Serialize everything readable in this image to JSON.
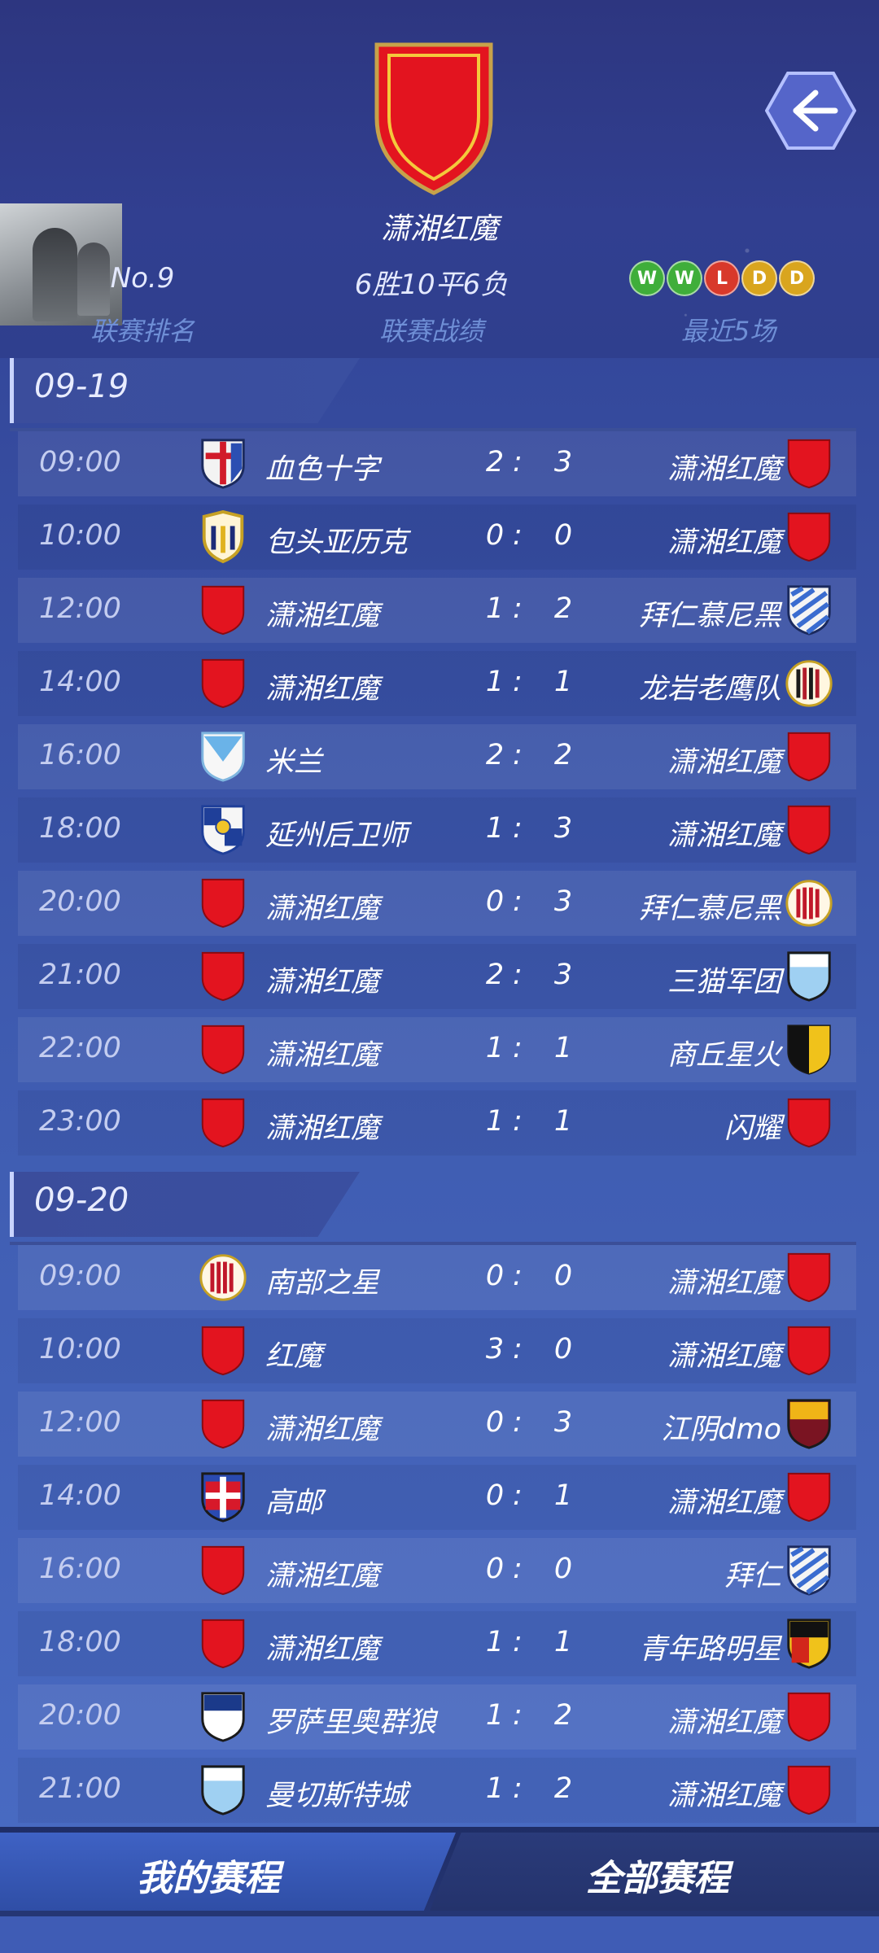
{
  "header": {
    "team_name": "潇湘红魔",
    "rank_value": "No.9",
    "rank_label": "联赛排名",
    "record_value": "6胜10平6负",
    "record_label": "联赛战绩",
    "recent_label": "最近5场",
    "recent_form": [
      {
        "r": "W",
        "color": "#3fae3a"
      },
      {
        "r": "W",
        "color": "#3fae3a"
      },
      {
        "r": "L",
        "color": "#d8392b"
      },
      {
        "r": "D",
        "color": "#d9a51e"
      },
      {
        "r": "D",
        "color": "#d9a51e"
      }
    ]
  },
  "dates": [
    {
      "date": "09-19",
      "matches": [
        {
          "time": "09:00",
          "home": "血色十字",
          "home_crest": "cross-shield",
          "hs": "2",
          "as": "3",
          "away": "潇湘红魔",
          "away_crest": "red-shield"
        },
        {
          "time": "10:00",
          "home": "包头亚历克",
          "home_crest": "gold-stripe-shield",
          "hs": "0",
          "as": "0",
          "away": "潇湘红魔",
          "away_crest": "red-shield"
        },
        {
          "time": "12:00",
          "home": "潇湘红魔",
          "home_crest": "red-shield",
          "hs": "1",
          "as": "2",
          "away": "拜仁慕尼黑",
          "away_crest": "blue-diagonal-shield"
        },
        {
          "time": "14:00",
          "home": "潇湘红魔",
          "home_crest": "red-shield",
          "hs": "1",
          "as": "1",
          "away": "龙岩老鹰队",
          "away_crest": "striped-round-badge"
        },
        {
          "time": "16:00",
          "home": "米兰",
          "home_crest": "light-blue-shield",
          "hs": "2",
          "as": "2",
          "away": "潇湘红魔",
          "away_crest": "red-shield"
        },
        {
          "time": "18:00",
          "home": "延州后卫师",
          "home_crest": "blue-cross-shield",
          "hs": "1",
          "as": "3",
          "away": "潇湘红魔",
          "away_crest": "red-shield"
        },
        {
          "time": "20:00",
          "home": "潇湘红魔",
          "home_crest": "red-shield",
          "hs": "0",
          "as": "3",
          "away": "拜仁慕尼黑",
          "away_crest": "red-stripe-round"
        },
        {
          "time": "21:00",
          "home": "潇湘红魔",
          "home_crest": "red-shield",
          "hs": "2",
          "as": "3",
          "away": "三猫军团",
          "away_crest": "sky-half-shield"
        },
        {
          "time": "22:00",
          "home": "潇湘红魔",
          "home_crest": "red-shield",
          "hs": "1",
          "as": "1",
          "away": "商丘星火",
          "away_crest": "black-yellow-shield"
        },
        {
          "time": "23:00",
          "home": "潇湘红魔",
          "home_crest": "red-shield",
          "hs": "1",
          "as": "1",
          "away": "闪耀",
          "away_crest": "red-shield"
        }
      ]
    },
    {
      "date": "09-20",
      "matches": [
        {
          "time": "09:00",
          "home": "南部之星",
          "home_crest": "red-stripe-round",
          "hs": "0",
          "as": "0",
          "away": "潇湘红魔",
          "away_crest": "red-shield"
        },
        {
          "time": "10:00",
          "home": "红魔",
          "home_crest": "red-shield",
          "hs": "3",
          "as": "0",
          "away": "潇湘红魔",
          "away_crest": "red-shield"
        },
        {
          "time": "12:00",
          "home": "潇湘红魔",
          "home_crest": "red-shield",
          "hs": "0",
          "as": "3",
          "away": "江阴dmo",
          "away_crest": "gold-maroon-shield"
        },
        {
          "time": "14:00",
          "home": "高邮",
          "home_crest": "red-blue-cross-shield",
          "hs": "0",
          "as": "1",
          "away": "潇湘红魔",
          "away_crest": "red-shield"
        },
        {
          "time": "16:00",
          "home": "潇湘红魔",
          "home_crest": "red-shield",
          "hs": "0",
          "as": "0",
          "away": "拜仁",
          "away_crest": "blue-diagonal-shield"
        },
        {
          "time": "18:00",
          "home": "潇湘红魔",
          "home_crest": "red-shield",
          "hs": "1",
          "as": "1",
          "away": "青年路明星",
          "away_crest": "black-red-yellow-shield"
        },
        {
          "time": "20:00",
          "home": "罗萨里奥群狼",
          "home_crest": "navy-white-shield",
          "hs": "1",
          "as": "2",
          "away": "潇湘红魔",
          "away_crest": "red-shield"
        },
        {
          "time": "21:00",
          "home": "曼切斯特城",
          "home_crest": "sky-half-shield",
          "hs": "1",
          "as": "2",
          "away": "潇湘红魔",
          "away_crest": "red-shield"
        }
      ]
    }
  ],
  "tabs": {
    "mine": "我的赛程",
    "all": "全部赛程"
  },
  "colors": {
    "accent_red": "#e3141f",
    "label_blue": "#6f8fd6"
  }
}
